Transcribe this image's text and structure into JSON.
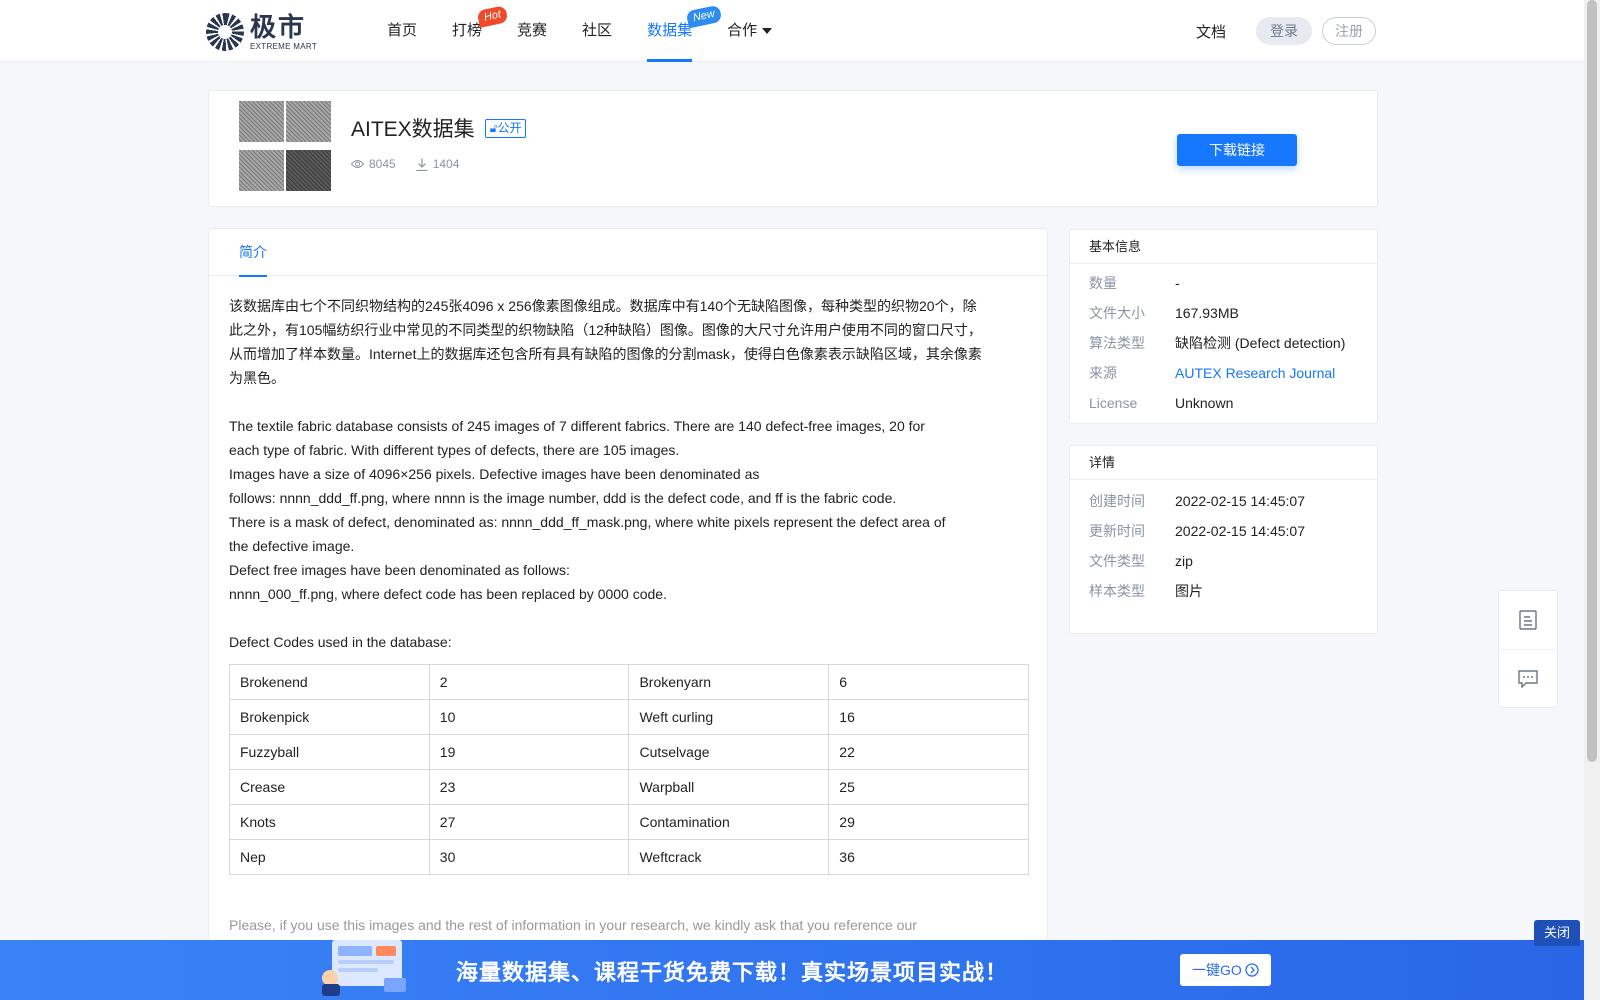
{
  "header": {
    "logo_cn": "极市",
    "logo_en": "EXTREME MART",
    "nav": [
      {
        "label": "首页",
        "badge": ""
      },
      {
        "label": "打榜",
        "badge": "Hot"
      },
      {
        "label": "竞赛",
        "badge": ""
      },
      {
        "label": "社区",
        "badge": ""
      },
      {
        "label": "数据集",
        "badge": "New",
        "active": true
      },
      {
        "label": "合作",
        "badge": "",
        "has_dropdown": true
      }
    ],
    "docs": "文档",
    "login": "登录",
    "register": "注册"
  },
  "dataset": {
    "title": "AITEX数据集",
    "tag": "公开",
    "views": "8045",
    "downloads": "1404",
    "download_button": "下载链接"
  },
  "tabs": [
    "简介"
  ],
  "description": {
    "cn_lines": [
      "该数据库由七个不同织物结构的245张4096 x 256像素图像组成。数据库中有140个无缺陷图像，每种类型的织物20个，除",
      "此之外，有105幅纺织行业中常见的不同类型的织物缺陷（12种缺陷）图像。图像的大尺寸允许用户使用不同的窗口尺寸，",
      "从而增加了样本数量。Internet上的数据库还包含所有具有缺陷的图像的分割mask，使得白色像素表示缺陷区域，其余像素",
      "为黑色。"
    ],
    "en_lines": [
      "The textile fabric database consists of 245 images of 7 different fabrics. There are 140 defect-free images, 20 for",
      "each type of fabric. With different types of defects, there are 105 images.",
      "Images have a size of 4096×256 pixels. Defective images have been denominated as",
      "follows: nnnn_ddd_ff.png, where nnnn is the image number, ddd is the defect code, and ff is the fabric code.",
      "There is a mask of defect, denominated as: nnnn_ddd_ff_mask.png, where white pixels represent the defect area of",
      "the defective image.",
      "Defect free images have been denominated as follows:",
      "nnnn_000_ff.png, where defect code has been replaced by 0000 code."
    ],
    "codes_heading": "Defect Codes used in the database:",
    "codes_table": [
      [
        "Brokenend",
        "2",
        "Brokenyarn",
        "6"
      ],
      [
        "Brokenpick",
        "10",
        "Weft curling",
        "16"
      ],
      [
        "Fuzzyball",
        "19",
        "Cutselvage",
        "22"
      ],
      [
        "Crease",
        "23",
        "Warpball",
        "25"
      ],
      [
        "Knots",
        "27",
        "Contamination",
        "29"
      ],
      [
        "Nep",
        "30",
        "Weftcrack",
        "36"
      ]
    ],
    "trailing_text": "Please, if you use this images and the rest of information in your research, we kindly ask that you reference our"
  },
  "basic_info": {
    "heading": "基本信息",
    "rows": [
      {
        "key": "数量",
        "value": "-"
      },
      {
        "key": "文件大小",
        "value": "167.93MB"
      },
      {
        "key": "算法类型",
        "value": "缺陷检测 (Defect detection)"
      },
      {
        "key": "来源",
        "value": "AUTEX Research Journal",
        "link": true
      },
      {
        "key": "License",
        "value": "Unknown"
      }
    ]
  },
  "details": {
    "heading": "详情",
    "rows": [
      {
        "key": "创建时间",
        "value": "2022-02-15 14:45:07"
      },
      {
        "key": "更新时间",
        "value": "2022-02-15 14:45:07"
      },
      {
        "key": "文件类型",
        "value": "zip"
      },
      {
        "key": "样本类型",
        "value": "图片"
      }
    ]
  },
  "banner": {
    "text": "海量数据集、课程干货免费下载！真实场景项目实战！",
    "button": "一键GO",
    "close": "关闭"
  },
  "colors": {
    "accent": "#1677ff",
    "banner": "#3b82f6",
    "hot": "#f04a2a"
  }
}
